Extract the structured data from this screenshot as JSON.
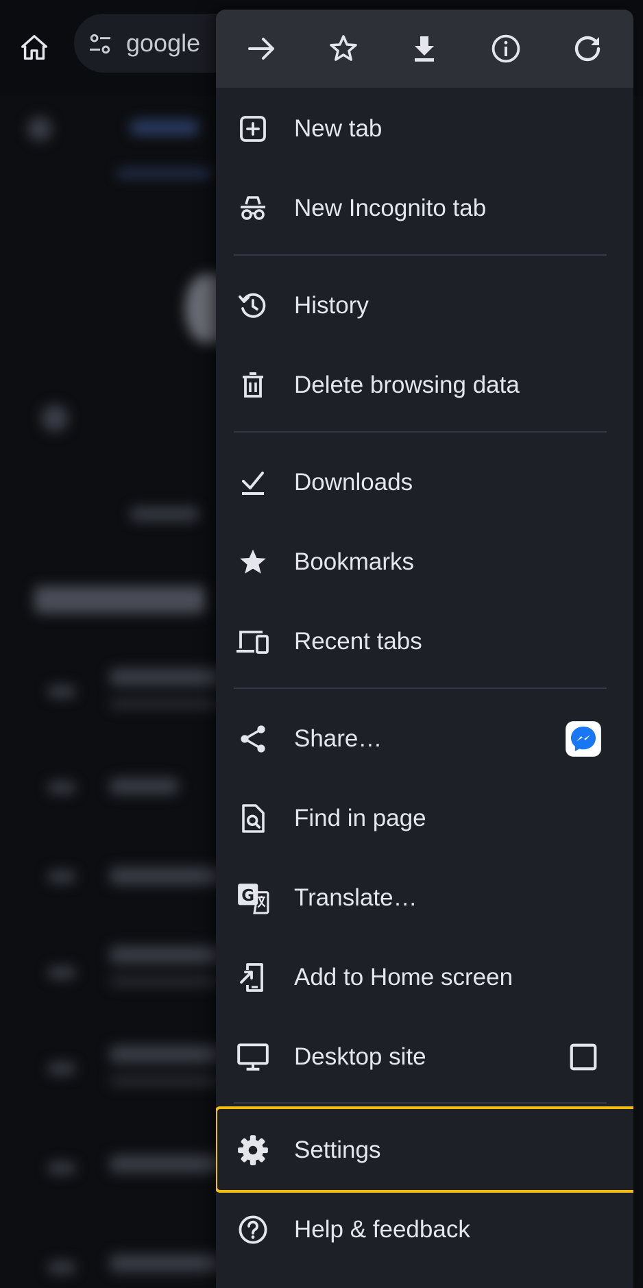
{
  "background": {
    "address_text": "google"
  },
  "menu": {
    "icon_row": [
      "forward-icon",
      "bookmark-star-icon",
      "download-icon",
      "info-icon",
      "refresh-icon"
    ],
    "items": [
      {
        "label": "New tab",
        "icon": "new-tab-icon"
      },
      {
        "label": "New Incognito tab",
        "icon": "incognito-icon"
      },
      {
        "label": "History",
        "icon": "history-icon"
      },
      {
        "label": "Delete browsing data",
        "icon": "trash-icon"
      },
      {
        "label": "Downloads",
        "icon": "downloads-icon"
      },
      {
        "label": "Bookmarks",
        "icon": "star-icon"
      },
      {
        "label": "Recent tabs",
        "icon": "devices-icon"
      },
      {
        "label": "Share…",
        "icon": "share-icon"
      },
      {
        "label": "Find in page",
        "icon": "find-in-page-icon"
      },
      {
        "label": "Translate…",
        "icon": "translate-icon"
      },
      {
        "label": "Add to Home screen",
        "icon": "add-to-home-icon"
      },
      {
        "label": "Desktop site",
        "icon": "desktop-icon"
      },
      {
        "label": "Settings",
        "icon": "gear-icon"
      },
      {
        "label": "Help & feedback",
        "icon": "help-icon"
      }
    ],
    "highlight_color": "#f3bc13",
    "messenger_color": "#1877f2"
  }
}
